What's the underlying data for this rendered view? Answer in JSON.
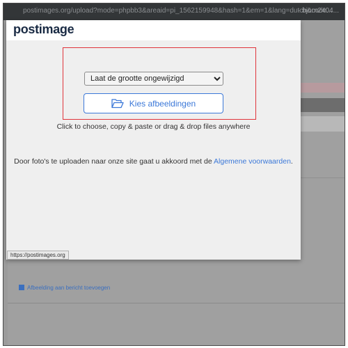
{
  "browser": {
    "url": "postimages.org/upload?mode=phpbb3&areaid=pi_1562159948&hash=1&em=1&lang=dutch&code...",
    "tab_text": "· bjorn2404..."
  },
  "modal": {
    "logo": "postimage",
    "size_select": {
      "value": "Laat de grootte ongewijzigd",
      "options": [
        "Laat de grootte ongewijzigd"
      ]
    },
    "choose_button_label": "Kies afbeeldingen",
    "hint": "Click to choose, copy & paste or drag & drop files anywhere",
    "terms_prefix": "Door foto's te uploaden naar onze site gaat u akkoord met de ",
    "terms_link": "Algemene voorwaarden",
    "terms_suffix": "."
  },
  "background": {
    "link_text": "Afbeelding aan bericht toevoegen"
  },
  "status_tip": "https://postimages.org",
  "colors": {
    "accent": "#3b78d8",
    "highlight_border": "#e0333a",
    "logo": "#1a2b44"
  },
  "icons": {
    "choose_button": "folder-open-icon"
  }
}
